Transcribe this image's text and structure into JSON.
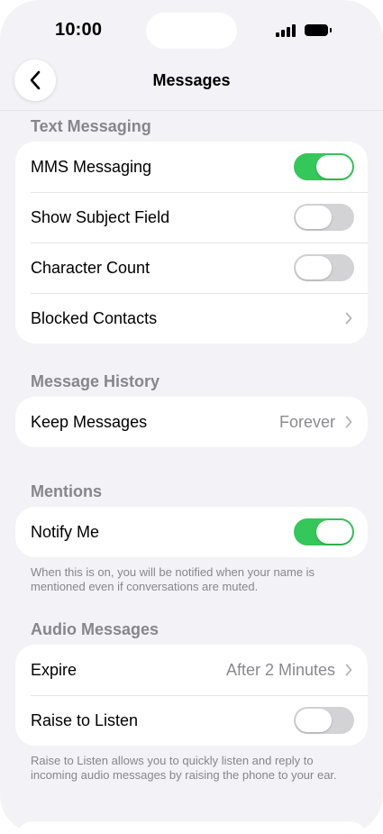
{
  "status_bar": {
    "time": "10:00"
  },
  "nav": {
    "title": "Messages"
  },
  "sections": {
    "text_messaging": {
      "header": "Text Messaging",
      "rows": [
        {
          "label": "MMS Messaging",
          "toggle": true
        },
        {
          "label": "Show Subject Field",
          "toggle": false
        },
        {
          "label": "Character Count",
          "toggle": false
        },
        {
          "label": "Blocked Contacts"
        }
      ]
    },
    "message_history": {
      "header": "Message History",
      "keep_messages": {
        "label": "Keep Messages",
        "value": "Forever"
      }
    },
    "mentions": {
      "header": "Mentions",
      "notify_me": {
        "label": "Notify Me",
        "toggle": true
      },
      "footnote": "When this is on, you will be notified when your name is mentioned even if conversations are muted."
    },
    "audio_messages": {
      "header": "Audio Messages",
      "expire": {
        "label": "Expire",
        "value": "After 2 Minutes"
      },
      "raise_to_listen": {
        "label": "Raise to Listen",
        "toggle": false
      },
      "footnote": "Raise to Listen allows you to quickly listen and reply to incoming audio messages by raising the phone to your ear."
    }
  },
  "colors": {
    "toggle_on": "#34c759",
    "toggle_off": "#d3d3d6",
    "background": "#f2f2f7"
  }
}
